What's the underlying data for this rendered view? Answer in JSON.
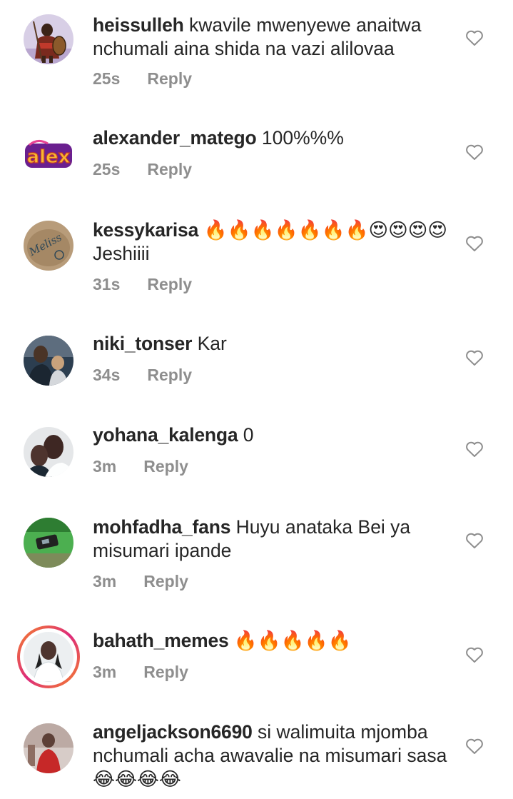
{
  "comments": [
    {
      "username": "heissulleh",
      "text": "kwavile mwenyewe anaitwa nchumali aina shida na vazi alilovaa",
      "time": "25s",
      "reply_label": "Reply",
      "avatar": "avatar-warrior-with-shield",
      "story_ring": false
    },
    {
      "username": "alexander_matego",
      "text": "100%%%",
      "time": "25s",
      "reply_label": "Reply",
      "avatar": "avatar-alex-graffiti-logo",
      "story_ring": false
    },
    {
      "username": "kessykarisa",
      "text": "🔥🔥🔥🔥🔥🔥🔥😍😍😍😍 Jeshiiii",
      "time": "31s",
      "reply_label": "Reply",
      "avatar": "avatar-melissa-tattoo",
      "story_ring": false
    },
    {
      "username": "niki_tonser",
      "text": "Kar",
      "time": "34s",
      "reply_label": "Reply",
      "avatar": "avatar-man-with-child",
      "story_ring": false
    },
    {
      "username": "yohana_kalenga",
      "text": "0",
      "time": "3m",
      "reply_label": "Reply",
      "avatar": "avatar-two-people-selfie",
      "story_ring": false
    },
    {
      "username": "mohfadha_fans",
      "text": "Huyu anataka Bei ya misumari ipande",
      "time": "3m",
      "reply_label": "Reply",
      "avatar": "avatar-object-on-grass",
      "story_ring": false
    },
    {
      "username": "bahath_memes",
      "text": "🔥🔥🔥🔥🔥",
      "time": "3m",
      "reply_label": "Reply",
      "avatar": "avatar-woman-portrait",
      "story_ring": true
    },
    {
      "username": "angeljackson6690",
      "text": "si walimuita mjomba nchumali acha awavalie na misumari sasa😂😂😂😂",
      "time": "",
      "reply_label": "",
      "avatar": "avatar-woman-red-dress",
      "story_ring": false
    }
  ],
  "icons": {
    "like": "heart-outline-icon"
  },
  "colors": {
    "text": "#262626",
    "meta": "#8e8e8e",
    "heart_stroke": "#8e8e8e",
    "story_ring_start": "#f58529",
    "story_ring_end": "#dd2a7b"
  }
}
